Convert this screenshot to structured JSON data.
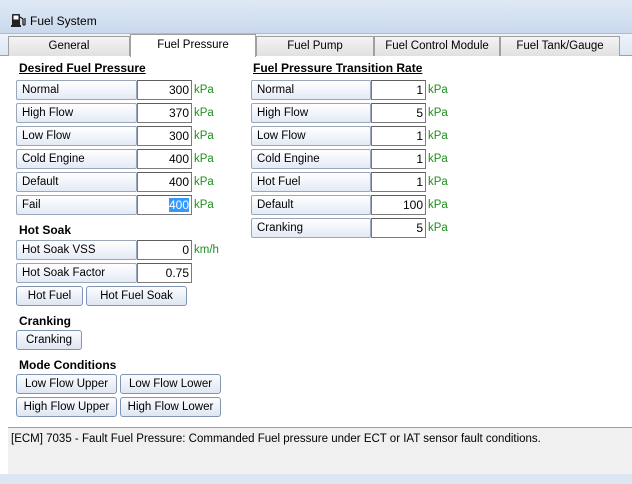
{
  "window": {
    "title": "Fuel System"
  },
  "tabs": [
    {
      "label": "General"
    },
    {
      "label": "Fuel Pressure"
    },
    {
      "label": "Fuel Pump"
    },
    {
      "label": "Fuel Control Module"
    },
    {
      "label": "Fuel Tank/Gauge"
    }
  ],
  "active_tab": "Fuel Pressure",
  "desired": {
    "title": "Desired Fuel Pressure",
    "unit": "kPa",
    "rows": [
      {
        "label": "Normal",
        "value": "300"
      },
      {
        "label": "High Flow",
        "value": "370"
      },
      {
        "label": "Low Flow",
        "value": "300"
      },
      {
        "label": "Cold Engine",
        "value": "400"
      },
      {
        "label": "Default",
        "value": "400"
      },
      {
        "label": "Fail",
        "value": "400"
      }
    ]
  },
  "transition": {
    "title": "Fuel Pressure Transition Rate",
    "unit": "kPa",
    "rows": [
      {
        "label": "Normal",
        "value": "1"
      },
      {
        "label": "High Flow",
        "value": "5"
      },
      {
        "label": "Low Flow",
        "value": "1"
      },
      {
        "label": "Cold Engine",
        "value": "1"
      },
      {
        "label": "Hot Fuel",
        "value": "1"
      },
      {
        "label": "Default",
        "value": "100"
      },
      {
        "label": "Cranking",
        "value": "5"
      }
    ]
  },
  "hot_soak": {
    "title": "Hot Soak",
    "vss_label": "Hot Soak VSS",
    "vss_value": "0",
    "vss_unit": "km/h",
    "factor_label": "Hot Soak Factor",
    "factor_value": "0.75",
    "hot_fuel_button": "Hot Fuel",
    "hot_fuel_soak_button": "Hot Fuel Soak"
  },
  "cranking": {
    "title": "Cranking",
    "button": "Cranking"
  },
  "mode_conditions": {
    "title": "Mode Conditions",
    "low_flow_upper": "Low Flow Upper",
    "low_flow_lower": "Low Flow Lower",
    "high_flow_upper": "High Flow Upper",
    "high_flow_lower": "High Flow Lower"
  },
  "status": {
    "message": "[ECM] 7035 - Fault Fuel Pressure: Commanded Fuel pressure under ECT or IAT sensor fault conditions."
  },
  "icons": {
    "window": "fuel-pump-icon"
  },
  "colors": {
    "unit_text": "#1f8f1f",
    "selection": "#3399ff"
  }
}
